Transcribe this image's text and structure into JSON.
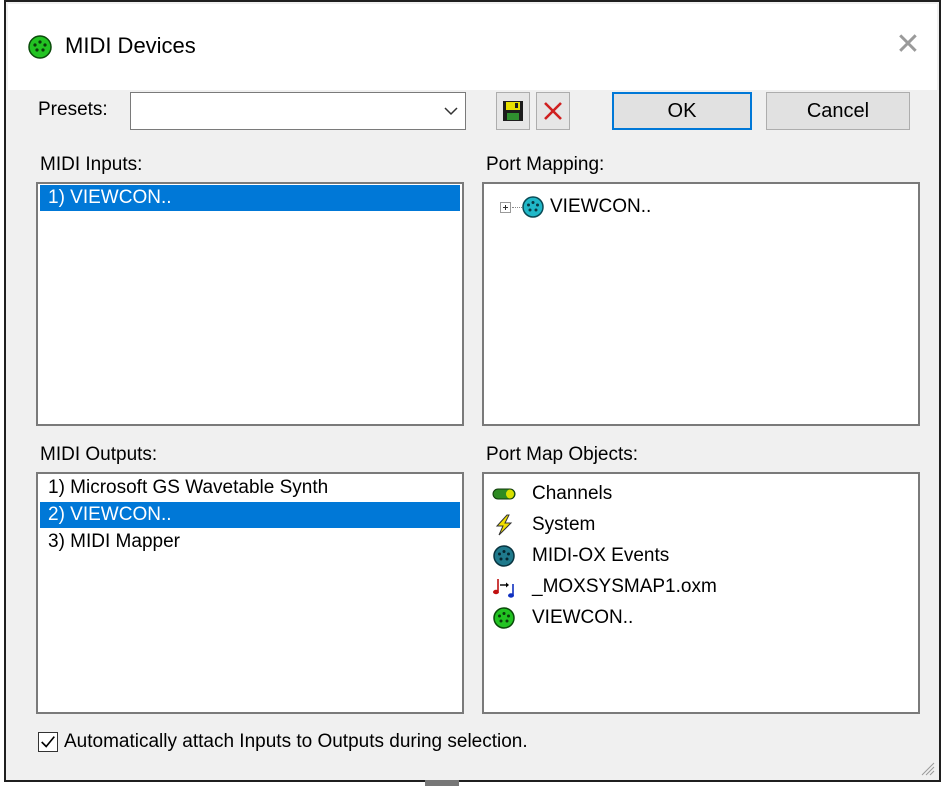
{
  "window": {
    "title": "MIDI Devices",
    "close_symbol": "✕",
    "title_icon": "midi-port-icon"
  },
  "presets": {
    "label": "Presets:",
    "value": "",
    "save_icon": "save-icon",
    "delete_icon": "delete-icon"
  },
  "buttons": {
    "ok": "OK",
    "cancel": "Cancel"
  },
  "inputs": {
    "label": "MIDI Inputs:",
    "items": [
      {
        "label": "1) VIEWCON..",
        "selected": true
      }
    ]
  },
  "port_mapping": {
    "label": "Port Mapping:",
    "root": "VIEWCON.."
  },
  "outputs": {
    "label": "MIDI Outputs:",
    "items": [
      {
        "label": "1) Microsoft GS Wavetable Synth",
        "selected": false
      },
      {
        "label": "2) VIEWCON..",
        "selected": true
      },
      {
        "label": "3) MIDI Mapper",
        "selected": false
      }
    ]
  },
  "port_map_objects": {
    "label": "Port Map Objects:",
    "items": [
      {
        "label": "Channels",
        "icon": "channels-icon"
      },
      {
        "label": "System",
        "icon": "system-icon"
      },
      {
        "label": "MIDI-OX Events",
        "icon": "midi-ox-events-icon"
      },
      {
        "label": "_MOXSYSMAP1.oxm",
        "icon": "map-file-icon"
      },
      {
        "label": "VIEWCON..",
        "icon": "midi-port-icon"
      }
    ]
  },
  "auto_attach": {
    "label": "Automatically attach Inputs to Outputs during selection.",
    "checked": true
  },
  "colors": {
    "selection": "#0078d7",
    "dialog_bg": "#f0f0f0",
    "midi_port_green": "#22c322",
    "midi_event_teal": "#1f7a8c"
  }
}
